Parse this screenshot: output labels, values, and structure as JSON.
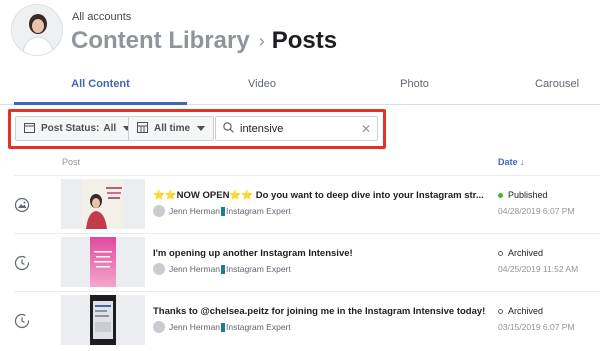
{
  "header": {
    "breadcrumb_top": "All accounts",
    "parent": "Content Library",
    "separator": "›",
    "current": "Posts"
  },
  "tabs": [
    {
      "label": "All Content",
      "active": true
    },
    {
      "label": "Video",
      "active": false
    },
    {
      "label": "Photo",
      "active": false
    },
    {
      "label": "Carousel",
      "active": false
    }
  ],
  "filters": {
    "post_status_label": "Post Status:",
    "post_status_value": "All",
    "date_range": "All time",
    "search_value": "intensive",
    "search_icon": "search-icon",
    "clear_icon": "close-icon"
  },
  "columns": {
    "post": "Post",
    "date": "Date ↓"
  },
  "colors": {
    "accent": "#4267b2",
    "highlight": "#e53227",
    "published": "#42b72a"
  },
  "rows": [
    {
      "type_icon": "photo-icon",
      "thumb_caption": "Personalized Instagram Training",
      "title": "⭐⭐NOW OPEN⭐⭐ Do you want to deep dive into your Instagram str...",
      "author": "Jenn Herman",
      "author_suffix": "Instagram Expert",
      "status": "Published",
      "date": "04/28/2019 6:07 PM"
    },
    {
      "type_icon": "clock-icon",
      "thumb_caption": "I'm opening up another Instagram Intensive",
      "title": "I'm opening up another Instagram Intensive!",
      "author": "Jenn Herman",
      "author_suffix": "Instagram Expert",
      "status": "Archived",
      "date": "04/25/2019 11:52 AM"
    },
    {
      "type_icon": "clock-icon",
      "thumb_caption": "",
      "title": "Thanks to @chelsea.peitz for joining me in the Instagram Intensive today!",
      "author": "Jenn Herman",
      "author_suffix": "Instagram Expert",
      "status": "Archived",
      "date": "03/15/2019 6:07 PM"
    }
  ]
}
